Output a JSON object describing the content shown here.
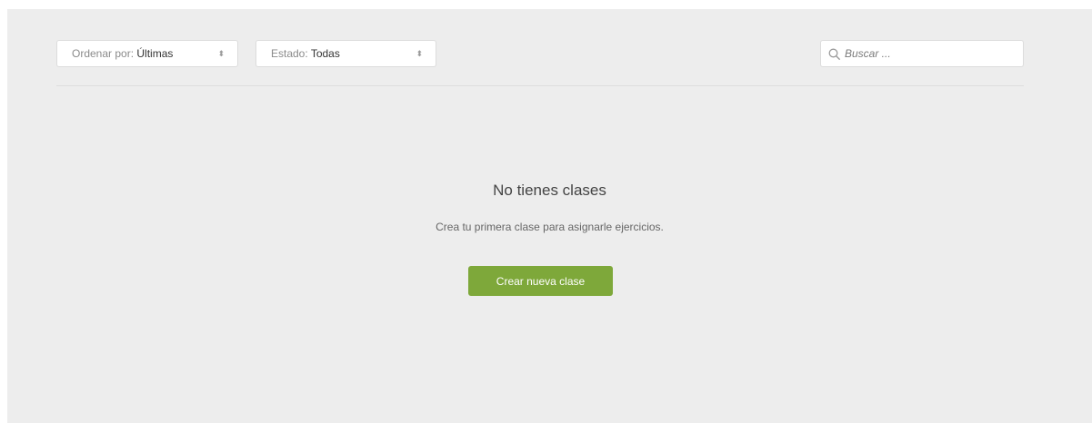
{
  "filters": {
    "sort": {
      "label": "Ordenar por:",
      "value": "Últimas",
      "icon": "sort-arrows-icon"
    },
    "status": {
      "label": "Estado:",
      "value": "Todas",
      "icon": "sort-arrows-icon"
    }
  },
  "search": {
    "placeholder": "Buscar ...",
    "value": "",
    "icon": "search-icon"
  },
  "empty_state": {
    "title": "No tienes clases",
    "subtitle": "Crea tu primera clase para asignarle ejercicios.",
    "button_label": "Crear nueva clase"
  },
  "colors": {
    "panel_background": "#ededed",
    "primary_button": "#7ea83a"
  }
}
